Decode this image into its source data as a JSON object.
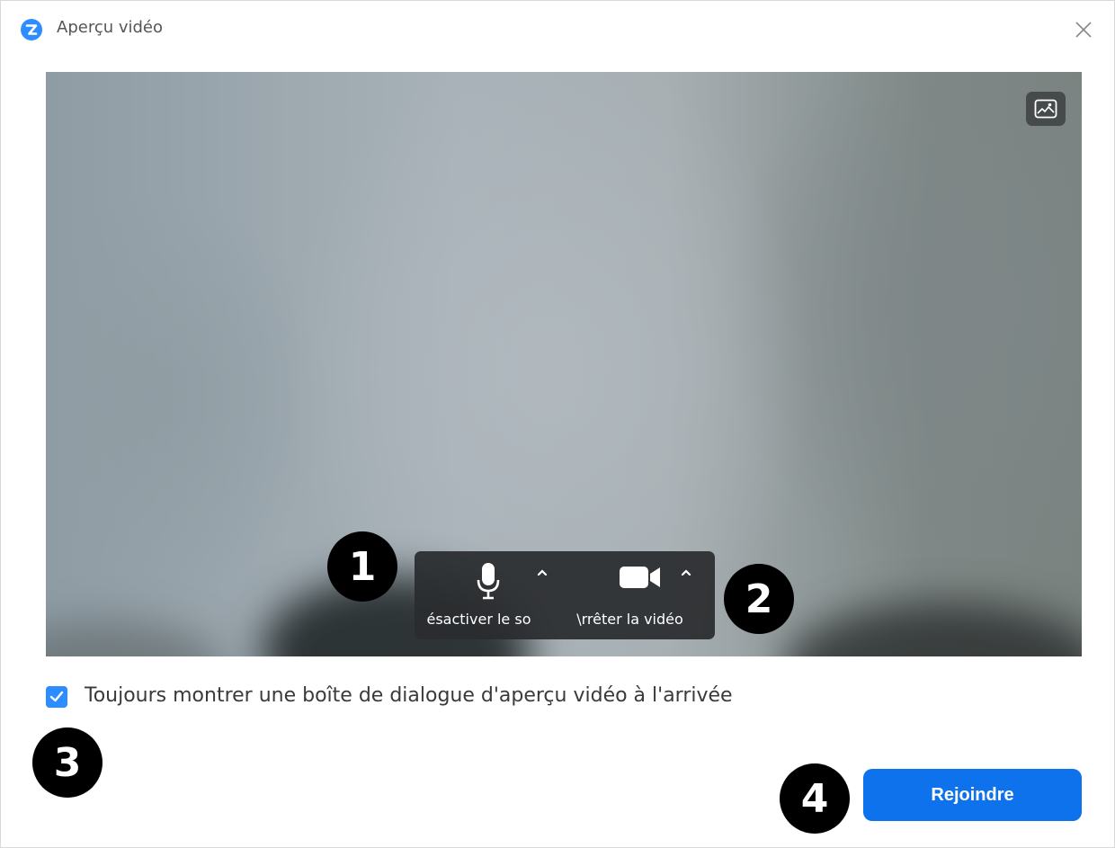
{
  "window": {
    "title": "Aperçu vidéo",
    "app_icon": "zoom-logo-icon",
    "close_icon": "close-icon"
  },
  "video": {
    "background_button_icon": "virtual-background-icon"
  },
  "controls": {
    "audio": {
      "label": "ésactiver le so",
      "icon": "microphone-icon",
      "caret_icon": "chevron-up-icon"
    },
    "video": {
      "label": "\\rrêter la vidéo",
      "icon": "video-camera-icon",
      "caret_icon": "chevron-up-icon"
    }
  },
  "checkbox": {
    "label": "Toujours montrer une boîte de dialogue d'aperçu vidéo à l'arrivée",
    "checked": true
  },
  "join_button": {
    "label": "Rejoindre"
  },
  "markers": [
    "1",
    "2",
    "3",
    "4"
  ],
  "colors": {
    "accent": "#2d8cff",
    "join_button": "#0e72ed",
    "controls_bar": "#2a2c2e",
    "marker": "#000000"
  }
}
